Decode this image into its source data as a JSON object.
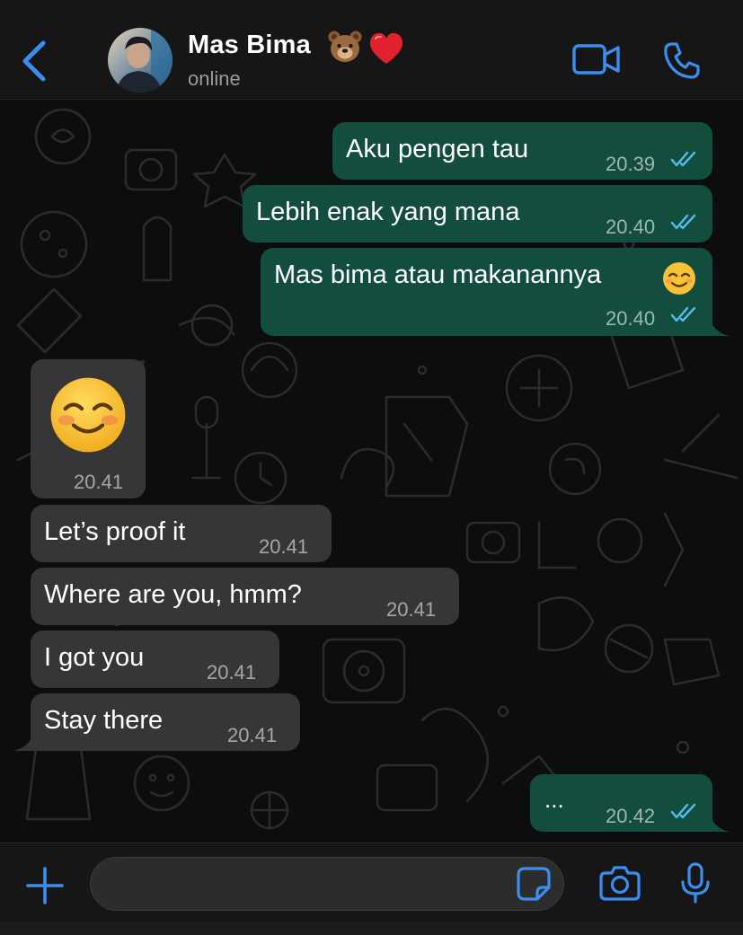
{
  "header": {
    "back_icon": "chevron-left-icon",
    "contact_name": "Mas Bima",
    "contact_emoji_1": "bear-face",
    "contact_emoji_2": "red-heart",
    "status": "online",
    "video_icon": "video-camera-icon",
    "call_icon": "phone-icon"
  },
  "messages": [
    {
      "direction": "out",
      "text": "Aku pengen tau",
      "time": "20.39",
      "read": true
    },
    {
      "direction": "out",
      "text": "Lebih enak yang mana",
      "time": "20.40",
      "read": true
    },
    {
      "direction": "out",
      "text": "Mas bima atau makanannya",
      "emoji": "smiling-face",
      "time": "20.40",
      "read": true
    },
    {
      "direction": "in",
      "emoji": "smiling-face",
      "time": "20.41"
    },
    {
      "direction": "in",
      "text": "Let’s proof it",
      "time": "20.41"
    },
    {
      "direction": "in",
      "text": "Where are you, hmm?",
      "time": "20.41"
    },
    {
      "direction": "in",
      "text": "I got you",
      "time": "20.41"
    },
    {
      "direction": "in",
      "text": "Stay there",
      "time": "20.41"
    },
    {
      "direction": "out",
      "text": "...",
      "time": "20.42",
      "read": true
    }
  ],
  "input_bar": {
    "plus_icon": "plus-icon",
    "message_value": "",
    "sticker_icon": "sticker-icon",
    "camera_icon": "camera-icon",
    "mic_icon": "microphone-icon"
  },
  "colors": {
    "accent": "#3b8ef0",
    "outgoing_bubble": "#134d3d",
    "incoming_bubble": "#363636",
    "read_ticks": "#53bdeb"
  }
}
